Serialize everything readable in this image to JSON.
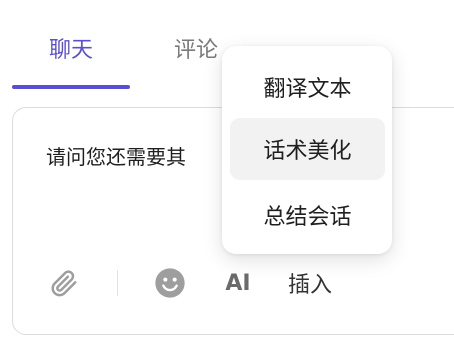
{
  "tabs": [
    {
      "label": "聊天",
      "active": true
    },
    {
      "label": "评论",
      "active": false
    }
  ],
  "editor": {
    "text": "请问您还需要其"
  },
  "toolbar": {
    "attach_icon": "paperclip-icon",
    "emoji_icon": "smiley-icon",
    "ai_label": "AI",
    "insert_label": "插入"
  },
  "menu": {
    "items": [
      {
        "label": "翻译文本"
      },
      {
        "label": "话术美化",
        "hovered": true
      },
      {
        "label": "总结会话"
      }
    ]
  },
  "colors": {
    "accent": "#5b4fd1",
    "hover_bg": "#f2f2f2",
    "icon_gray": "#9e9e9e"
  }
}
